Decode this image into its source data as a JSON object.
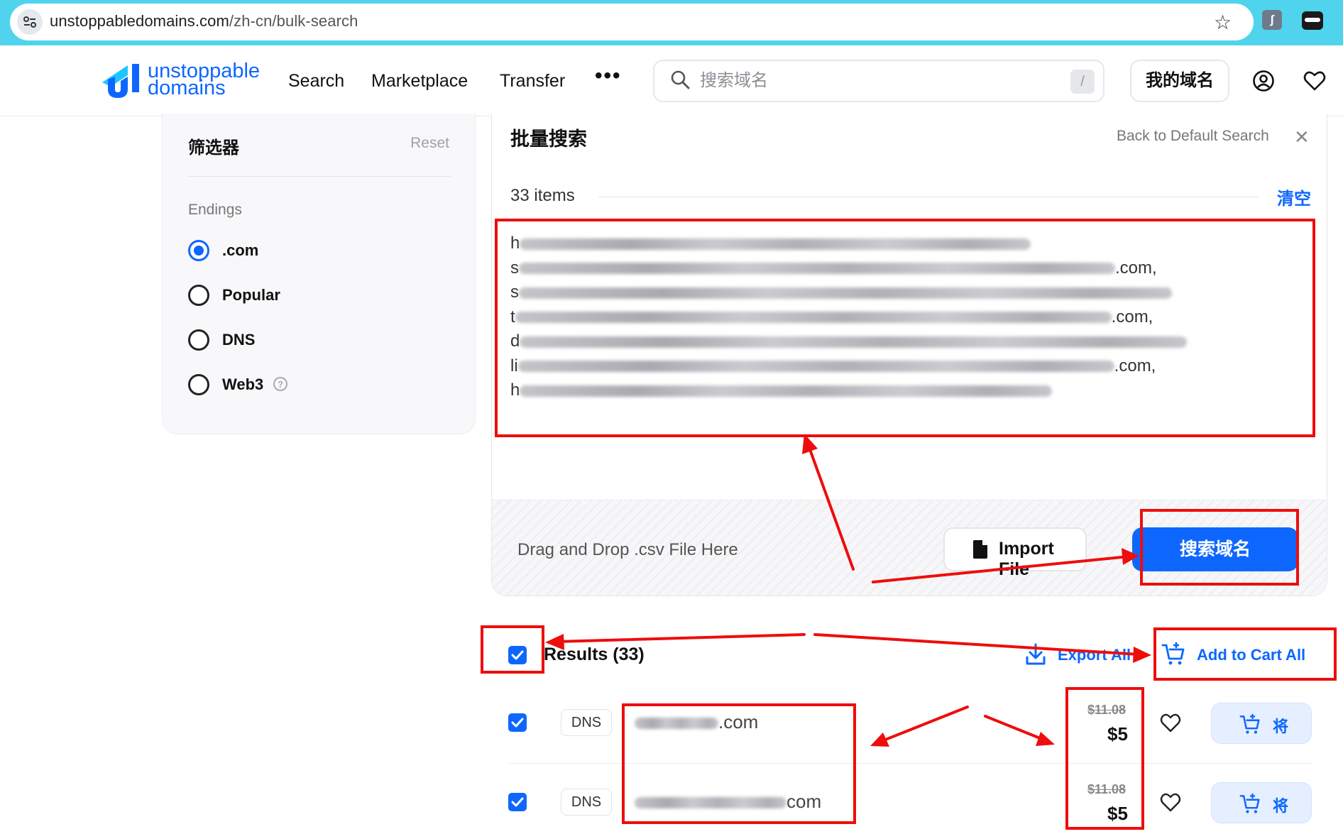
{
  "browser": {
    "url_host": "unstoppabledomains.com",
    "url_path": "/zh-cn/bulk-search"
  },
  "header": {
    "logo_line1": "unstoppable",
    "logo_line2": "domains",
    "nav": [
      "Search",
      "Marketplace",
      "Transfer"
    ],
    "more": "•••",
    "search_placeholder": "搜索域名",
    "search_shortcut": "/",
    "my_domains": "我的域名"
  },
  "filters": {
    "title": "筛选器",
    "reset": "Reset",
    "endings_label": "Endings",
    "options": [
      {
        "label": ".com",
        "checked": true
      },
      {
        "label": "Popular",
        "checked": false
      },
      {
        "label": "DNS",
        "checked": false
      },
      {
        "label": "Web3",
        "checked": false,
        "help": "?"
      }
    ]
  },
  "bulk": {
    "title": "批量搜索",
    "back_default": "Back to Default Search",
    "items_count": "33 items",
    "clear": "清空",
    "domain_lines": [
      {
        "prefix": "h",
        "suffix": ""
      },
      {
        "prefix": "s",
        "suffix": ".com,"
      },
      {
        "prefix": "s",
        "suffix": ""
      },
      {
        "prefix": "t",
        "suffix": ".com,"
      },
      {
        "prefix": "d",
        "suffix": ""
      },
      {
        "prefix": "li",
        "suffix": ".com,"
      },
      {
        "prefix": "h",
        "suffix": ""
      }
    ],
    "drop_text": "Drag and Drop .csv File Here",
    "import_button": "Import File",
    "search_button": "搜索域名"
  },
  "results": {
    "title": "Results (33)",
    "export_all": "Export All",
    "add_to_cart_all": "Add to Cart All",
    "rows": [
      {
        "badge": "DNS",
        "tld": ".com",
        "old_price": "$11.08",
        "price": "$5",
        "cart_label": "将",
        "checked": true
      },
      {
        "badge": "DNS",
        "tld": "com",
        "old_price": "$11.08",
        "price": "$5",
        "cart_label": "将",
        "checked": true
      }
    ]
  },
  "colors": {
    "accent": "#0d67fe",
    "annotation_red": "#ee0d0d",
    "browser_bar": "#50d4ee"
  }
}
